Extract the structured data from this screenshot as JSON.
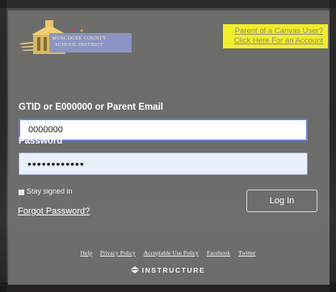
{
  "district": {
    "name_line1": "Muscogee County",
    "name_line2": "School District"
  },
  "parent_account": {
    "line1": "Parent of a Canvas User?",
    "line2": "Click Here For an Account"
  },
  "login": {
    "username_label": "GTID or E000000 or Parent Email",
    "username_value": "0000000",
    "password_label": "Password",
    "password_value": "••••••••••••",
    "stay_signed_in_label": "Stay signed in",
    "forgot_password": "Forgot Password?",
    "login_button": "Log In"
  },
  "footer": {
    "links": [
      "Help",
      "Privacy Policy",
      "Acceptable Use Policy",
      "Facebook",
      "Twitter"
    ],
    "brand": "INSTRUCTURE"
  },
  "colors": {
    "highlight": "#f3ee2a",
    "input_focus_border": "#6a7ed2",
    "autofill_bg": "#e8effd"
  },
  "icons": [
    "district-logo",
    "instructure-logo-icon"
  ]
}
